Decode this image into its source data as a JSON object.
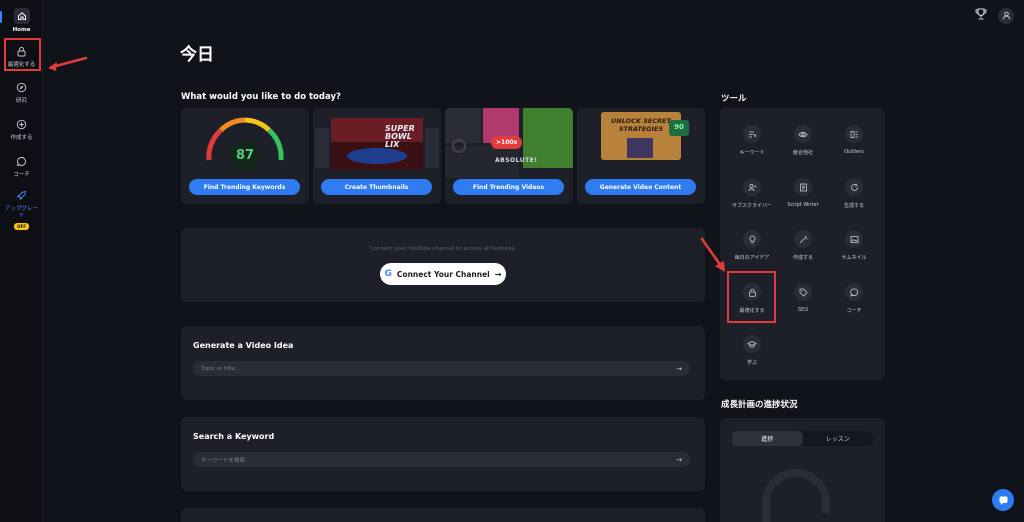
{
  "sidebar": {
    "items": [
      {
        "label": "Home",
        "icon": "home-icon"
      },
      {
        "label": "最適化する",
        "icon": "lock-icon"
      },
      {
        "label": "研究",
        "icon": "compass-icon"
      },
      {
        "label": "作成する",
        "icon": "plus-circle-icon"
      },
      {
        "label": "コーチ",
        "icon": "chat-icon"
      },
      {
        "label": "アップグレード",
        "icon": "rocket-icon",
        "badge": "OFF"
      }
    ]
  },
  "header": {
    "icons": [
      "trophy-icon",
      "user-icon"
    ]
  },
  "page": {
    "title": "今日"
  },
  "today": {
    "heading": "What would you like to do today?",
    "cards": [
      {
        "button": "Find Trending Keywords",
        "score": "87"
      },
      {
        "button": "Create Thumbnails",
        "image_text": "SUPER BOWL LIX"
      },
      {
        "button": "Find Trending Videos",
        "image_text": ">100x",
        "image_text2": "ABSOLUTE!"
      },
      {
        "button": "Generate Video Content",
        "image_text": "UNLOCK SECRET STRATEGIES",
        "score": "90"
      }
    ]
  },
  "connect": {
    "text": "Connect your YouTube channel to access all features.",
    "button": "Connect Your Channel",
    "g": "G"
  },
  "idea": {
    "title": "Generate a Video Idea",
    "placeholder": "Topic or title..."
  },
  "keyword": {
    "title": "Search a Keyword",
    "placeholder": "キーワードを検索"
  },
  "tools": {
    "heading": "ツール",
    "items": [
      {
        "label": "キーワード",
        "icon": "keyword-list-icon"
      },
      {
        "label": "競合他社",
        "icon": "eye-icon"
      },
      {
        "label": "Outliers",
        "icon": "outliers-icon"
      },
      {
        "label": "サブスクライバー",
        "icon": "subscribers-icon"
      },
      {
        "label": "Script Writer",
        "icon": "script-icon"
      },
      {
        "label": "生成する",
        "icon": "refresh-icon"
      },
      {
        "label": "毎日のアイデア",
        "icon": "lightbulb-icon"
      },
      {
        "label": "作成する",
        "icon": "magic-wand-icon"
      },
      {
        "label": "サムネイル",
        "icon": "image-icon"
      },
      {
        "label": "最適化する",
        "icon": "lock-icon"
      },
      {
        "label": "SEO",
        "icon": "tag-icon"
      },
      {
        "label": "コーチ",
        "icon": "chat-icon"
      },
      {
        "label": "学ぶ",
        "icon": "graduation-cap-icon"
      }
    ]
  },
  "progress": {
    "heading": "成長計画の進捗状況",
    "tabs": [
      "進捗",
      "レッスン"
    ],
    "active_tab": "進捗"
  },
  "colors": {
    "accent": "#2f7bf2",
    "annotation": "#e23b3b",
    "background": "#11131a",
    "panel": "#1d2029"
  }
}
